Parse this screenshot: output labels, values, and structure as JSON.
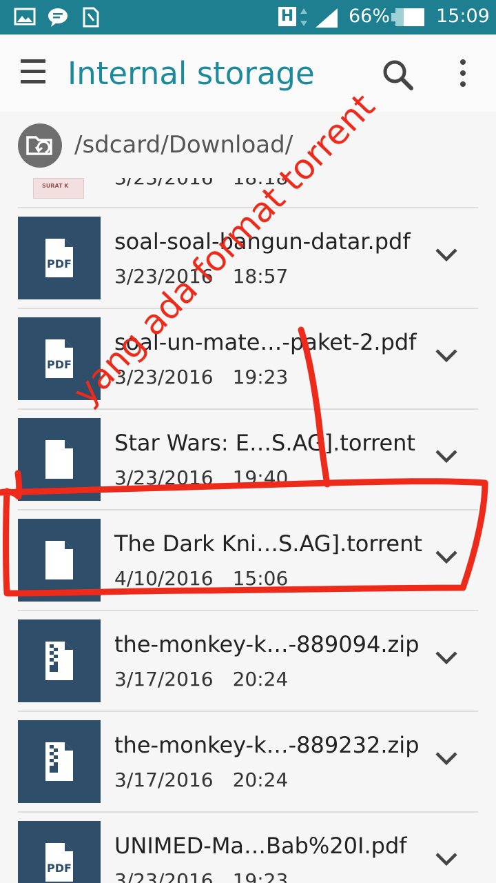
{
  "status_bar": {
    "icons": [
      "gallery-icon",
      "message-icon",
      "sim-icon",
      "network-h-icon",
      "signal-icon",
      "battery-icon"
    ],
    "network_type": "H",
    "battery_percent": "66%",
    "time": "15:09"
  },
  "app_bar": {
    "title": "Internal storage",
    "icons": [
      "menu-icon",
      "search-icon",
      "more-vert-icon"
    ]
  },
  "path": {
    "icon": "folder-switch-icon",
    "text": "/sdcard/Download/"
  },
  "colors": {
    "status_bar": "#1d7f8f",
    "title": "#1a8a9c",
    "thumbnail": "#2e4e69",
    "annotation": "#ee2a1b"
  },
  "partial_row": {
    "thumb_text": "SURAT K",
    "date": "3/23/2016",
    "time": "18:18"
  },
  "files": [
    {
      "name": "soal-soal-bangun-datar.pdf",
      "date": "3/23/2016",
      "time": "18:57",
      "type": "pdf",
      "icon": "pdf-file-icon",
      "label": "PDF"
    },
    {
      "name": "soal-un-mate…-paket-2.pdf",
      "date": "3/23/2016",
      "time": "19:23",
      "type": "pdf",
      "icon": "pdf-file-icon",
      "label": "PDF"
    },
    {
      "name": "Star Wars: E…S.AG].torrent",
      "date": "3/23/2016",
      "time": "19:40",
      "type": "file",
      "icon": "file-icon",
      "label": ""
    },
    {
      "name": "The Dark Kni…S.AG].torrent",
      "date": "4/10/2016",
      "time": "15:06",
      "type": "file",
      "icon": "file-icon",
      "label": ""
    },
    {
      "name": "the-monkey-k…-889094.zip",
      "date": "3/17/2016",
      "time": "20:24",
      "type": "zip",
      "icon": "zip-file-icon",
      "label": ""
    },
    {
      "name": "the-monkey-k…-889232.zip",
      "date": "3/17/2016",
      "time": "20:24",
      "type": "zip",
      "icon": "zip-file-icon",
      "label": ""
    },
    {
      "name": "UNIMED-Ma…Bab%20I.pdf",
      "date": "3/23/2016",
      "time": "19:23",
      "type": "pdf",
      "icon": "pdf-file-icon",
      "label": "PDF"
    }
  ],
  "annotation": {
    "text": "yang ada format  torrent"
  }
}
